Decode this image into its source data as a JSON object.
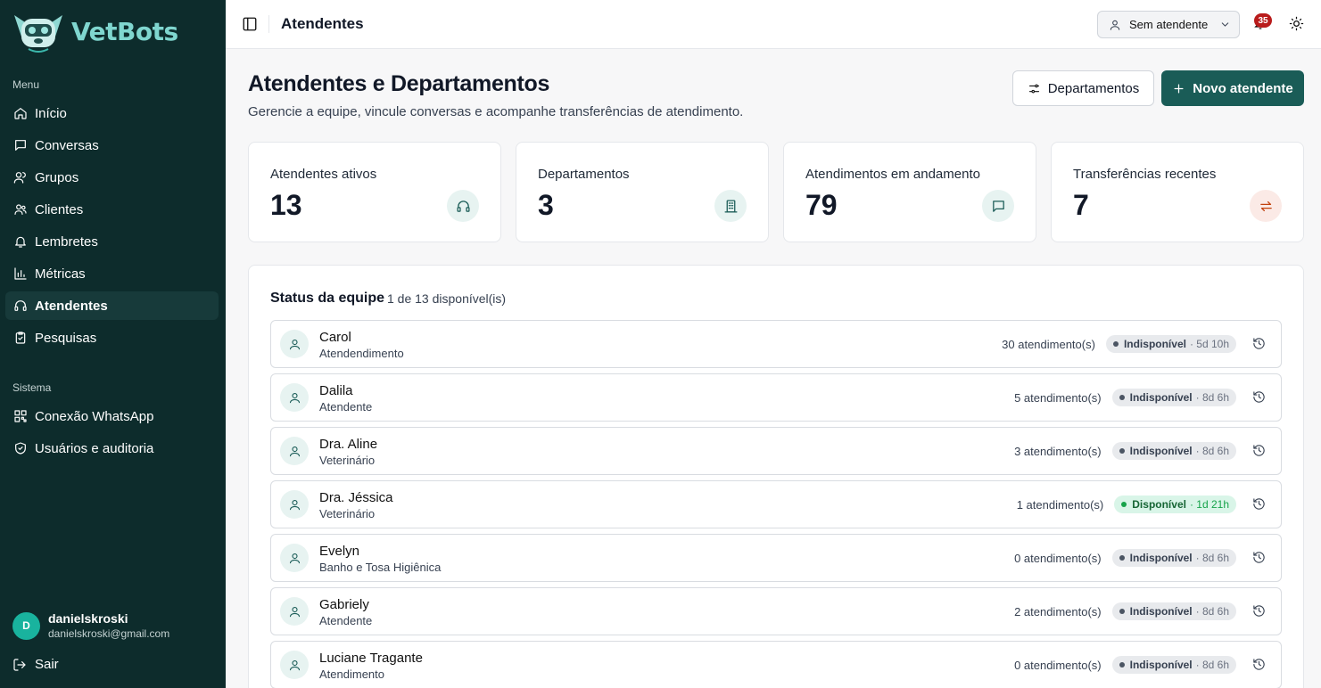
{
  "brand": {
    "name": "VetBots",
    "accent": "#1a5c57",
    "sidebar_bg": "#0d2c2c"
  },
  "sidebar": {
    "menu_label": "Menu",
    "items": [
      {
        "label": "Início",
        "icon": "home-icon"
      },
      {
        "label": "Conversas",
        "icon": "chat-icon"
      },
      {
        "label": "Grupos",
        "icon": "group-icon"
      },
      {
        "label": "Clientes",
        "icon": "users-icon"
      },
      {
        "label": "Lembretes",
        "icon": "bell-icon"
      },
      {
        "label": "Métricas",
        "icon": "chart-icon"
      },
      {
        "label": "Atendentes",
        "icon": "headset-icon",
        "active": true
      },
      {
        "label": "Pesquisas",
        "icon": "clipboard-icon"
      }
    ],
    "system_label": "Sistema",
    "system_items": [
      {
        "label": "Conexão WhatsApp",
        "icon": "qr-icon"
      },
      {
        "label": "Usuários e auditoria",
        "icon": "shield-icon"
      }
    ],
    "user": {
      "initial": "D",
      "name": "danielskroski",
      "email": "danielskroski@gmail.com"
    },
    "logout": "Sair"
  },
  "topbar": {
    "title": "Atendentes",
    "attendant_select": "Sem atendente",
    "notifications": "35"
  },
  "header": {
    "title": "Atendentes e Departamentos",
    "subtitle": "Gerencie a equipe, vincule conversas e acompanhe transferências de atendimento.",
    "departments_button": "Departamentos",
    "new_button": "Novo atendente"
  },
  "stats": [
    {
      "label": "Atendentes ativos",
      "value": "13",
      "icon": "headset-icon"
    },
    {
      "label": "Departamentos",
      "value": "3",
      "icon": "building-icon"
    },
    {
      "label": "Atendimentos em andamento",
      "value": "79",
      "icon": "chat-icon"
    },
    {
      "label": "Transferências recentes",
      "value": "7",
      "icon": "transfer-icon"
    }
  ],
  "team": {
    "title": "Status da equipe",
    "count": "1 de 13 disponível(is)",
    "rows": [
      {
        "name": "Carol",
        "dept": "Atendendimento",
        "count": "30 atendimento(s)",
        "status": "Indisponível",
        "time": "· 5d 10h",
        "available": false
      },
      {
        "name": "Dalila",
        "dept": "Atendente",
        "count": "5 atendimento(s)",
        "status": "Indisponível",
        "time": "· 8d 6h",
        "available": false
      },
      {
        "name": "Dra. Aline",
        "dept": "Veterinário",
        "count": "3 atendimento(s)",
        "status": "Indisponível",
        "time": "· 8d 6h",
        "available": false
      },
      {
        "name": "Dra. Jéssica",
        "dept": "Veterinário",
        "count": "1 atendimento(s)",
        "status": "Disponível",
        "time": "· 1d 21h",
        "available": true
      },
      {
        "name": "Evelyn",
        "dept": "Banho e Tosa Higiênica",
        "count": "0 atendimento(s)",
        "status": "Indisponível",
        "time": "· 8d 6h",
        "available": false
      },
      {
        "name": "Gabriely",
        "dept": "Atendente",
        "count": "2 atendimento(s)",
        "status": "Indisponível",
        "time": "· 8d 6h",
        "available": false
      },
      {
        "name": "Luciane Tragante",
        "dept": "Atendimento",
        "count": "0 atendimento(s)",
        "status": "Indisponível",
        "time": "· 8d 6h",
        "available": false
      }
    ]
  }
}
